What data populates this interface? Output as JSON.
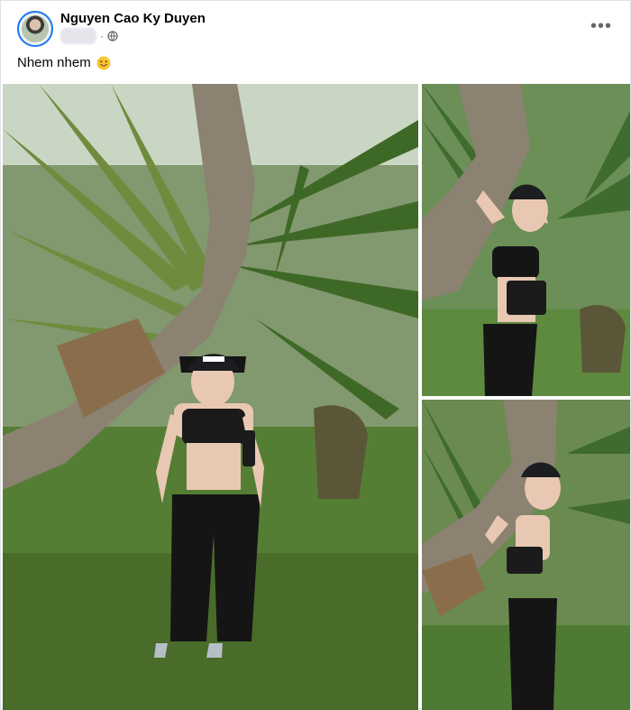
{
  "post": {
    "author": "Nguyen Cao Ky Duyen",
    "privacy_icon": "globe-icon",
    "more_icon": "more-horizontal-icon",
    "more_label": "•••",
    "separator": "·",
    "caption": "Nhem nhem",
    "caption_emoji": "face-with-tongue-emoji"
  },
  "photos": [
    {
      "id": "photo-1",
      "icon": "photo"
    },
    {
      "id": "photo-2",
      "icon": "photo"
    },
    {
      "id": "photo-3",
      "icon": "photo"
    }
  ],
  "colors": {
    "accent": "#1877f2",
    "secondary_text": "#65676b",
    "foliage": "#3f6b2e",
    "grass": "#5f8a3c",
    "trunk": "#8a7f70",
    "outfit": "#151515",
    "skin": "#e9c8b3"
  }
}
